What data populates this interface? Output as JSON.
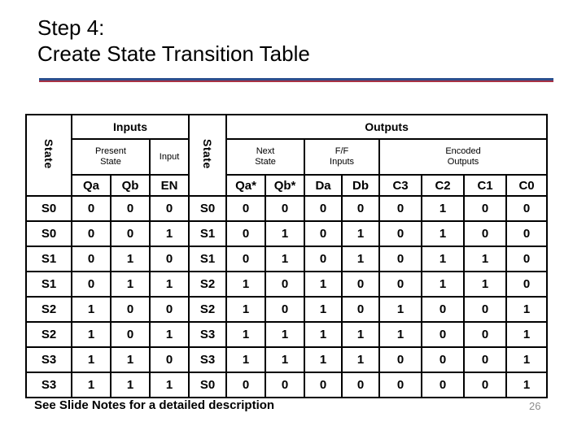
{
  "slide": {
    "title_line1": "Step 4:",
    "title_line2": "Create State Transition Table",
    "footer_note": "See Slide Notes for a detailed description",
    "page_number": "26",
    "accent_blue": "#2c4f8e",
    "accent_red": "#a83244",
    "page_number_color": "#8c8c8c"
  },
  "table": {
    "group_headers": {
      "inputs": "Inputs",
      "outputs": "Outputs"
    },
    "sub_headers": {
      "state_left": "State",
      "present_state": "Present\nState",
      "input": "Input",
      "state_right": "State",
      "next_state": "Next\nState",
      "ff_inputs": "F/F\nInputs",
      "encoded_outputs": "Encoded\nOutputs"
    },
    "sub_headers_lines": {
      "present_state_l1": "Present",
      "present_state_l2": "State",
      "input_l1": "Input",
      "next_state_l1": "Next",
      "next_state_l2": "State",
      "ff_inputs_l1": "F/F",
      "ff_inputs_l2": "Inputs",
      "encoded_l1": "Encoded",
      "encoded_l2": "Outputs"
    },
    "columns": [
      "Qa",
      "Qb",
      "EN",
      "Qa*",
      "Qb*",
      "Da",
      "Db",
      "C3",
      "C2",
      "C1",
      "C0"
    ],
    "rows": [
      {
        "state": "S0",
        "qa": "0",
        "qb": "0",
        "en": "0",
        "next_state": "S0",
        "qas": "0",
        "qbs": "0",
        "da": "0",
        "db": "0",
        "c3": "0",
        "c2": "1",
        "c1": "0",
        "c0": "0"
      },
      {
        "state": "S0",
        "qa": "0",
        "qb": "0",
        "en": "1",
        "next_state": "S1",
        "qas": "0",
        "qbs": "1",
        "da": "0",
        "db": "1",
        "c3": "0",
        "c2": "1",
        "c1": "0",
        "c0": "0"
      },
      {
        "state": "S1",
        "qa": "0",
        "qb": "1",
        "en": "0",
        "next_state": "S1",
        "qas": "0",
        "qbs": "1",
        "da": "0",
        "db": "1",
        "c3": "0",
        "c2": "1",
        "c1": "1",
        "c0": "0"
      },
      {
        "state": "S1",
        "qa": "0",
        "qb": "1",
        "en": "1",
        "next_state": "S2",
        "qas": "1",
        "qbs": "0",
        "da": "1",
        "db": "0",
        "c3": "0",
        "c2": "1",
        "c1": "1",
        "c0": "0"
      },
      {
        "state": "S2",
        "qa": "1",
        "qb": "0",
        "en": "0",
        "next_state": "S2",
        "qas": "1",
        "qbs": "0",
        "da": "1",
        "db": "0",
        "c3": "1",
        "c2": "0",
        "c1": "0",
        "c0": "1"
      },
      {
        "state": "S2",
        "qa": "1",
        "qb": "0",
        "en": "1",
        "next_state": "S3",
        "qas": "1",
        "qbs": "1",
        "da": "1",
        "db": "1",
        "c3": "1",
        "c2": "0",
        "c1": "0",
        "c0": "1"
      },
      {
        "state": "S3",
        "qa": "1",
        "qb": "1",
        "en": "0",
        "next_state": "S3",
        "qas": "1",
        "qbs": "1",
        "da": "1",
        "db": "1",
        "c3": "0",
        "c2": "0",
        "c1": "0",
        "c0": "1"
      },
      {
        "state": "S3",
        "qa": "1",
        "qb": "1",
        "en": "1",
        "next_state": "S0",
        "qas": "0",
        "qbs": "0",
        "da": "0",
        "db": "0",
        "c3": "0",
        "c2": "0",
        "c1": "0",
        "c0": "1"
      }
    ]
  }
}
